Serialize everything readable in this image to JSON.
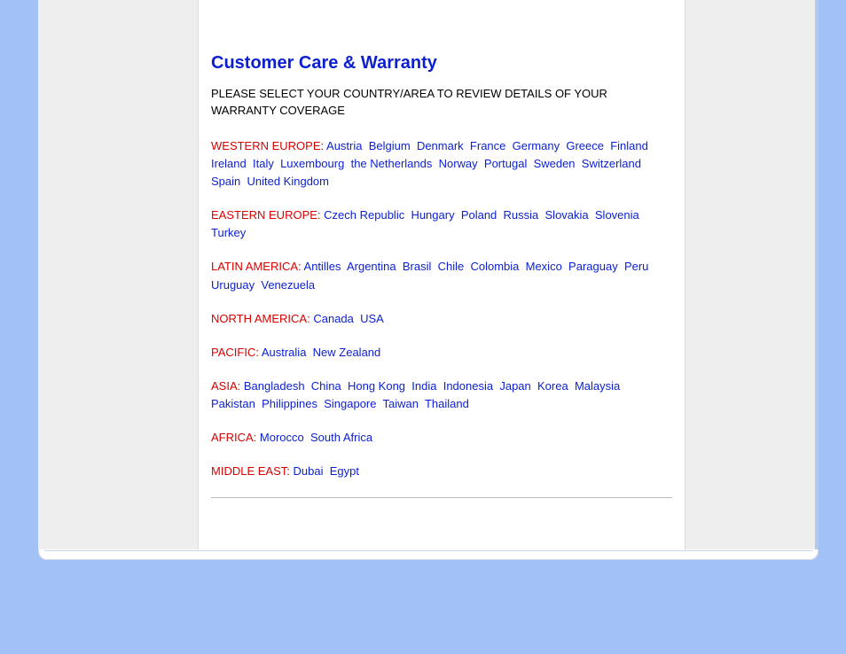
{
  "title": "Customer Care & Warranty",
  "instruction": "PLEASE SELECT YOUR COUNTRY/AREA TO REVIEW DETAILS OF YOUR WARRANTY COVERAGE",
  "regions": [
    {
      "label": "WESTERN EUROPE:",
      "countries": [
        "Austria",
        "Belgium",
        "Denmark",
        "France",
        "Germany",
        "Greece",
        "Finland",
        "Ireland",
        "Italy",
        "Luxembourg",
        "the Netherlands",
        "Norway",
        "Portugal",
        "Sweden",
        "Switzerland",
        "Spain",
        "United Kingdom"
      ]
    },
    {
      "label": "EASTERN EUROPE:",
      "countries": [
        "Czech Republic",
        "Hungary",
        "Poland",
        "Russia",
        "Slovakia",
        "Slovenia",
        "Turkey"
      ]
    },
    {
      "label": "LATIN AMERICA:",
      "countries": [
        "Antilles",
        "Argentina",
        "Brasil",
        "Chile",
        "Colombia",
        "Mexico",
        "Paraguay",
        "Peru",
        "Uruguay",
        "Venezuela"
      ]
    },
    {
      "label": "NORTH AMERICA:",
      "countries": [
        "Canada",
        "USA"
      ]
    },
    {
      "label": "PACIFIC:",
      "countries": [
        "Australia",
        "New Zealand"
      ]
    },
    {
      "label": "ASIA:",
      "countries": [
        "Bangladesh",
        "China",
        "Hong Kong",
        "India",
        "Indonesia",
        "Japan",
        "Korea",
        "Malaysia",
        "Pakistan",
        "Philippines",
        "Singapore",
        "Taiwan",
        "Thailand"
      ]
    },
    {
      "label": "AFRICA:",
      "countries": [
        "Morocco",
        "South Africa"
      ]
    },
    {
      "label": "MIDDLE EAST:",
      "countries": [
        "Dubai",
        "Egypt"
      ]
    }
  ]
}
